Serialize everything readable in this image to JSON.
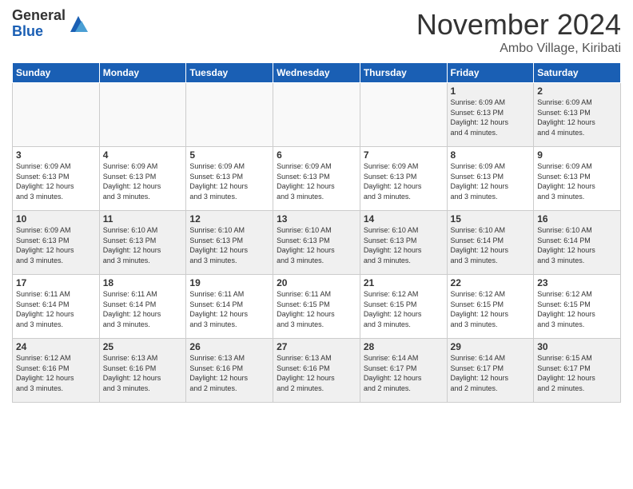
{
  "logo": {
    "general": "General",
    "blue": "Blue"
  },
  "header": {
    "title": "November 2024",
    "location": "Ambo Village, Kiribati"
  },
  "weekdays": [
    "Sunday",
    "Monday",
    "Tuesday",
    "Wednesday",
    "Thursday",
    "Friday",
    "Saturday"
  ],
  "weeks": [
    [
      {
        "day": "",
        "info": ""
      },
      {
        "day": "",
        "info": ""
      },
      {
        "day": "",
        "info": ""
      },
      {
        "day": "",
        "info": ""
      },
      {
        "day": "",
        "info": ""
      },
      {
        "day": "1",
        "info": "Sunrise: 6:09 AM\nSunset: 6:13 PM\nDaylight: 12 hours\nand 4 minutes."
      },
      {
        "day": "2",
        "info": "Sunrise: 6:09 AM\nSunset: 6:13 PM\nDaylight: 12 hours\nand 4 minutes."
      }
    ],
    [
      {
        "day": "3",
        "info": "Sunrise: 6:09 AM\nSunset: 6:13 PM\nDaylight: 12 hours\nand 3 minutes."
      },
      {
        "day": "4",
        "info": "Sunrise: 6:09 AM\nSunset: 6:13 PM\nDaylight: 12 hours\nand 3 minutes."
      },
      {
        "day": "5",
        "info": "Sunrise: 6:09 AM\nSunset: 6:13 PM\nDaylight: 12 hours\nand 3 minutes."
      },
      {
        "day": "6",
        "info": "Sunrise: 6:09 AM\nSunset: 6:13 PM\nDaylight: 12 hours\nand 3 minutes."
      },
      {
        "day": "7",
        "info": "Sunrise: 6:09 AM\nSunset: 6:13 PM\nDaylight: 12 hours\nand 3 minutes."
      },
      {
        "day": "8",
        "info": "Sunrise: 6:09 AM\nSunset: 6:13 PM\nDaylight: 12 hours\nand 3 minutes."
      },
      {
        "day": "9",
        "info": "Sunrise: 6:09 AM\nSunset: 6:13 PM\nDaylight: 12 hours\nand 3 minutes."
      }
    ],
    [
      {
        "day": "10",
        "info": "Sunrise: 6:09 AM\nSunset: 6:13 PM\nDaylight: 12 hours\nand 3 minutes."
      },
      {
        "day": "11",
        "info": "Sunrise: 6:10 AM\nSunset: 6:13 PM\nDaylight: 12 hours\nand 3 minutes."
      },
      {
        "day": "12",
        "info": "Sunrise: 6:10 AM\nSunset: 6:13 PM\nDaylight: 12 hours\nand 3 minutes."
      },
      {
        "day": "13",
        "info": "Sunrise: 6:10 AM\nSunset: 6:13 PM\nDaylight: 12 hours\nand 3 minutes."
      },
      {
        "day": "14",
        "info": "Sunrise: 6:10 AM\nSunset: 6:13 PM\nDaylight: 12 hours\nand 3 minutes."
      },
      {
        "day": "15",
        "info": "Sunrise: 6:10 AM\nSunset: 6:14 PM\nDaylight: 12 hours\nand 3 minutes."
      },
      {
        "day": "16",
        "info": "Sunrise: 6:10 AM\nSunset: 6:14 PM\nDaylight: 12 hours\nand 3 minutes."
      }
    ],
    [
      {
        "day": "17",
        "info": "Sunrise: 6:11 AM\nSunset: 6:14 PM\nDaylight: 12 hours\nand 3 minutes."
      },
      {
        "day": "18",
        "info": "Sunrise: 6:11 AM\nSunset: 6:14 PM\nDaylight: 12 hours\nand 3 minutes."
      },
      {
        "day": "19",
        "info": "Sunrise: 6:11 AM\nSunset: 6:14 PM\nDaylight: 12 hours\nand 3 minutes."
      },
      {
        "day": "20",
        "info": "Sunrise: 6:11 AM\nSunset: 6:15 PM\nDaylight: 12 hours\nand 3 minutes."
      },
      {
        "day": "21",
        "info": "Sunrise: 6:12 AM\nSunset: 6:15 PM\nDaylight: 12 hours\nand 3 minutes."
      },
      {
        "day": "22",
        "info": "Sunrise: 6:12 AM\nSunset: 6:15 PM\nDaylight: 12 hours\nand 3 minutes."
      },
      {
        "day": "23",
        "info": "Sunrise: 6:12 AM\nSunset: 6:15 PM\nDaylight: 12 hours\nand 3 minutes."
      }
    ],
    [
      {
        "day": "24",
        "info": "Sunrise: 6:12 AM\nSunset: 6:16 PM\nDaylight: 12 hours\nand 3 minutes."
      },
      {
        "day": "25",
        "info": "Sunrise: 6:13 AM\nSunset: 6:16 PM\nDaylight: 12 hours\nand 3 minutes."
      },
      {
        "day": "26",
        "info": "Sunrise: 6:13 AM\nSunset: 6:16 PM\nDaylight: 12 hours\nand 2 minutes."
      },
      {
        "day": "27",
        "info": "Sunrise: 6:13 AM\nSunset: 6:16 PM\nDaylight: 12 hours\nand 2 minutes."
      },
      {
        "day": "28",
        "info": "Sunrise: 6:14 AM\nSunset: 6:17 PM\nDaylight: 12 hours\nand 2 minutes."
      },
      {
        "day": "29",
        "info": "Sunrise: 6:14 AM\nSunset: 6:17 PM\nDaylight: 12 hours\nand 2 minutes."
      },
      {
        "day": "30",
        "info": "Sunrise: 6:15 AM\nSunset: 6:17 PM\nDaylight: 12 hours\nand 2 minutes."
      }
    ]
  ]
}
